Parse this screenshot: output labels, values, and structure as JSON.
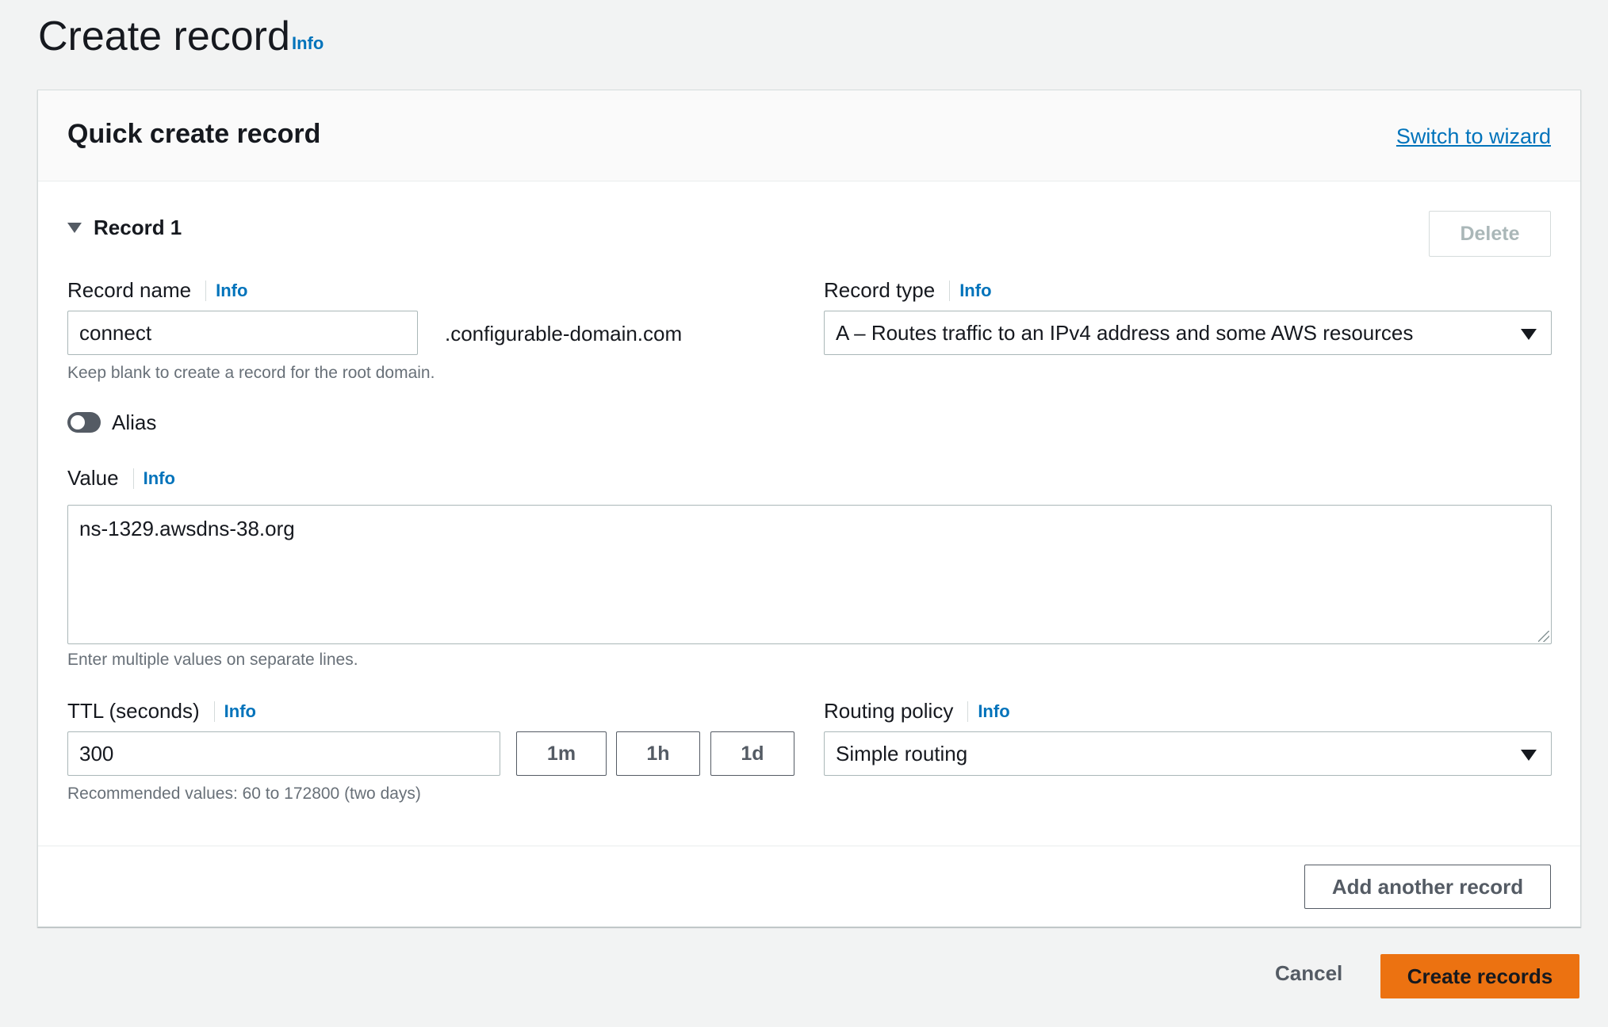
{
  "page": {
    "title": "Create record",
    "info_label": "Info"
  },
  "panel": {
    "title": "Quick create record",
    "switch_link": "Switch to wizard"
  },
  "record": {
    "heading": "Record 1",
    "delete_label": "Delete",
    "record_name": {
      "label": "Record name",
      "info": "Info",
      "value": "connect",
      "domain_suffix": ".configurable-domain.com",
      "hint": "Keep blank to create a record for the root domain."
    },
    "record_type": {
      "label": "Record type",
      "info": "Info",
      "selected": "A – Routes traffic to an IPv4 address and some AWS resources"
    },
    "alias": {
      "label": "Alias",
      "enabled": false
    },
    "value": {
      "label": "Value",
      "info": "Info",
      "text": "ns-1329.awsdns-38.org",
      "hint": "Enter multiple values on separate lines."
    },
    "ttl": {
      "label": "TTL (seconds)",
      "info": "Info",
      "value": "300",
      "presets": [
        "1m",
        "1h",
        "1d"
      ],
      "hint": "Recommended values: 60 to 172800 (two days)"
    },
    "routing_policy": {
      "label": "Routing policy",
      "info": "Info",
      "selected": "Simple routing"
    }
  },
  "actions": {
    "add_another": "Add another record",
    "cancel": "Cancel",
    "create": "Create records"
  },
  "colors": {
    "link": "#0073bb",
    "primary_button": "#ec7211",
    "background": "#f2f3f3",
    "toggle_off": "#545b64"
  }
}
